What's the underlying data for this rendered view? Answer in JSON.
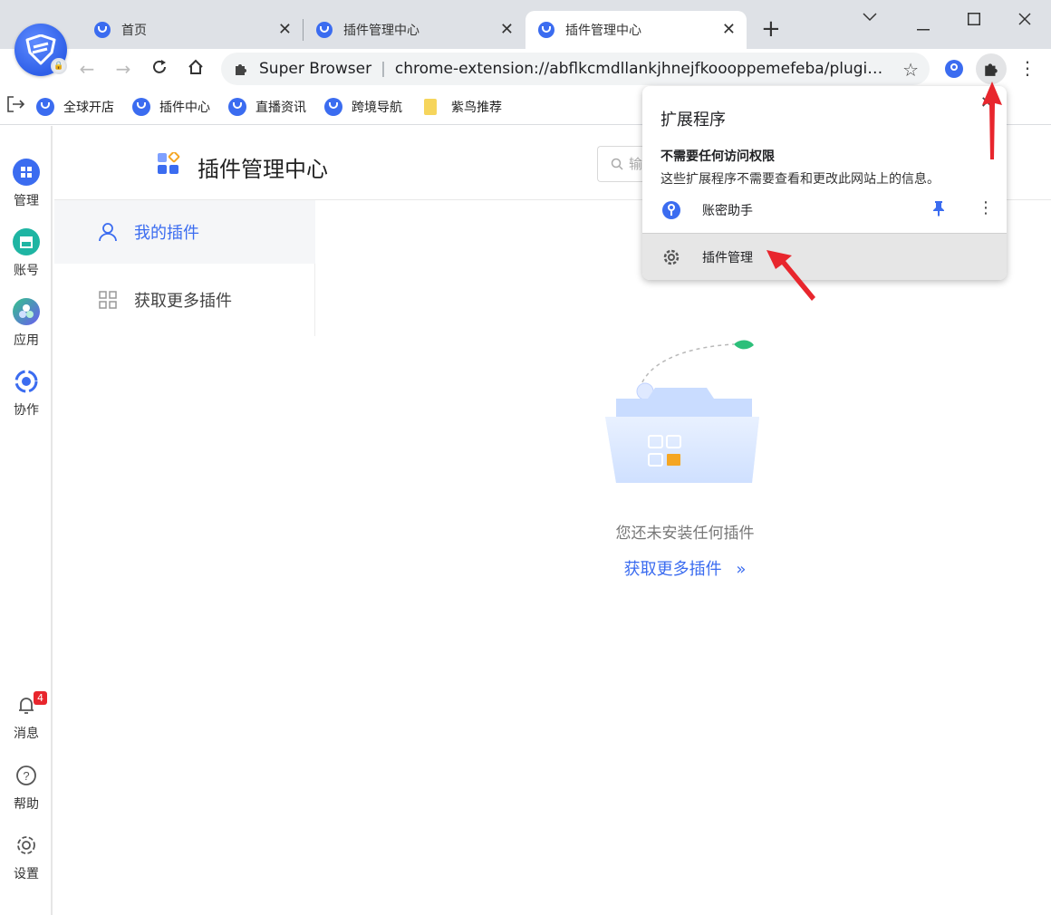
{
  "tabs": [
    {
      "label": "首页",
      "active": false
    },
    {
      "label": "插件管理中心",
      "active": false
    },
    {
      "label": "插件管理中心",
      "active": true
    }
  ],
  "address_bar": {
    "site_name": "Super Browser",
    "url": "chrome-extension://abflkcmdllankjhnejfkoooppemefeba/plugin..."
  },
  "bookmarks": [
    {
      "label": "全球开店",
      "icon": "app-logo-icon"
    },
    {
      "label": "插件中心",
      "icon": "app-logo-icon"
    },
    {
      "label": "直播资讯",
      "icon": "app-logo-icon"
    },
    {
      "label": "跨境导航",
      "icon": "app-logo-icon"
    },
    {
      "label": "紫鸟推荐",
      "icon": "folder-icon"
    }
  ],
  "sidebar": {
    "top_items": [
      {
        "label": "管理",
        "icon": "grid-icon"
      },
      {
        "label": "账号",
        "icon": "store-icon"
      },
      {
        "label": "应用",
        "icon": "apps-icon"
      },
      {
        "label": "协作",
        "icon": "collab-icon"
      }
    ],
    "bottom_items": [
      {
        "label": "消息",
        "icon": "bell-icon",
        "badge": "4"
      },
      {
        "label": "帮助",
        "icon": "help-icon"
      },
      {
        "label": "设置",
        "icon": "gear-icon"
      }
    ]
  },
  "page": {
    "title": "插件管理中心",
    "search_placeholder": "输",
    "nav": [
      {
        "label": "我的插件",
        "active": true
      },
      {
        "label": "获取更多插件",
        "active": false
      }
    ],
    "empty_text": "您还未安装任何插件",
    "empty_link": "获取更多插件"
  },
  "extensions_popup": {
    "title": "扩展程序",
    "section_heading": "不需要任何访问权限",
    "section_desc": "这些扩展程序不需要查看和更改此网站上的信息。",
    "items": [
      {
        "label": "账密助手"
      }
    ],
    "manage_label": "插件管理"
  },
  "colors": {
    "accent": "#3b6cf0",
    "annotation_arrow": "#e8262d",
    "badge": "#e8262d"
  }
}
